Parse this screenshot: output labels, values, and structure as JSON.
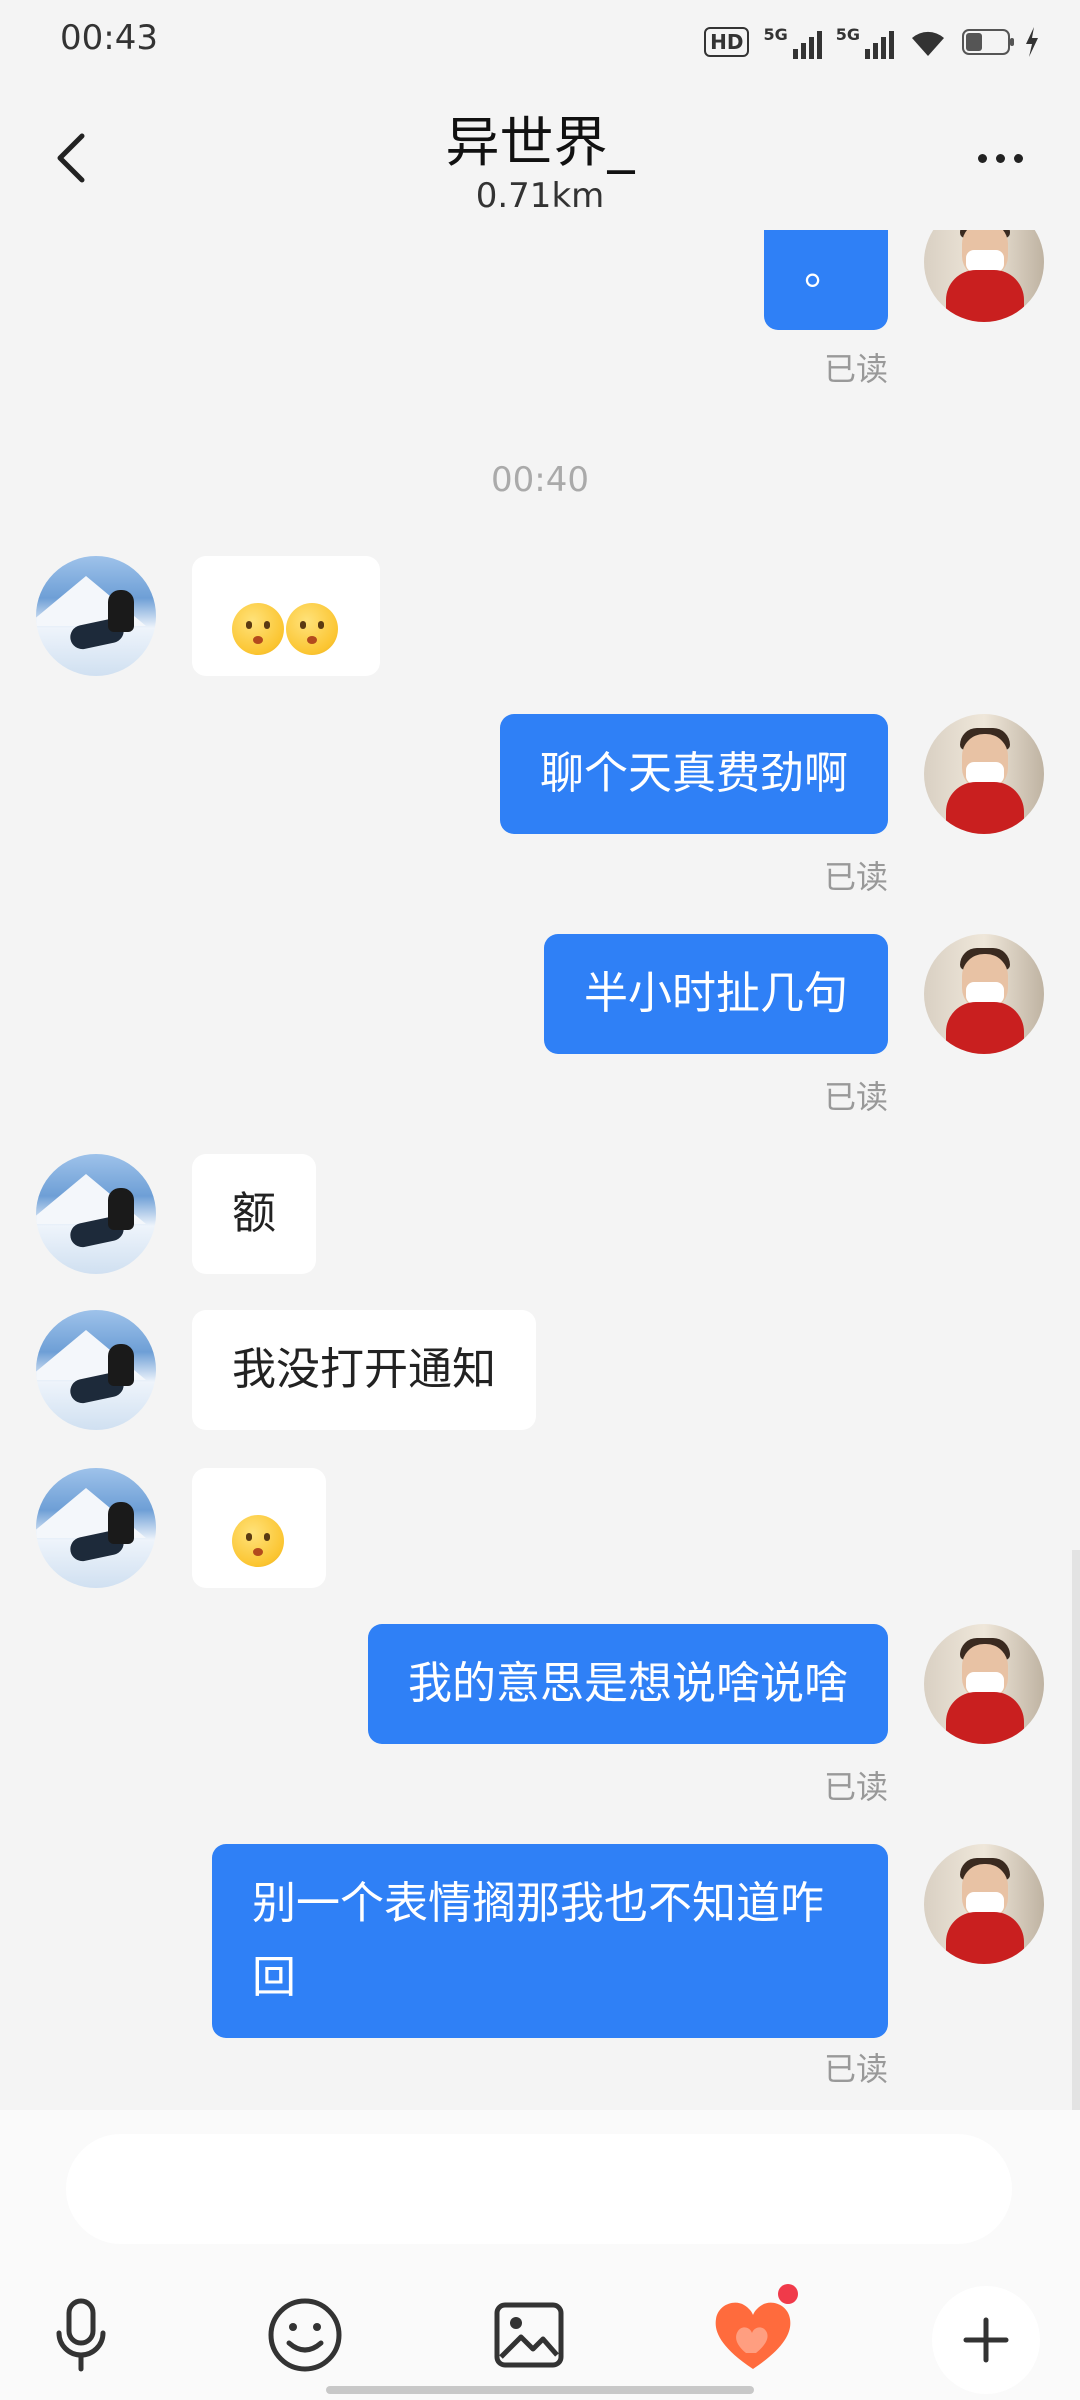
{
  "status_bar": {
    "time": "00:43",
    "hd_label": "HD",
    "network_1": "5G",
    "network_2": "5G",
    "battery_level": 0.45
  },
  "header": {
    "title": "异世界_",
    "distance": "0.71km"
  },
  "chat": {
    "messages": [
      {
        "from": "self",
        "text": "。",
        "status": "已读"
      },
      {
        "type": "timestamp",
        "text": "00:40"
      },
      {
        "from": "peer",
        "emoji_count": 2
      },
      {
        "from": "self",
        "text": "聊个天真费劲啊",
        "status": "已读"
      },
      {
        "from": "self",
        "text": "半小时扯几句",
        "status": "已读"
      },
      {
        "from": "peer",
        "text": "额"
      },
      {
        "from": "peer",
        "text": "我没打开通知"
      },
      {
        "from": "peer",
        "emoji_count": 1
      },
      {
        "from": "self",
        "text": "我的意思是想说啥说啥",
        "status": "已读"
      },
      {
        "from": "self",
        "text": "别一个表情搁那我也不知道咋回",
        "status": "已读"
      }
    ]
  },
  "input": {
    "placeholder": ""
  },
  "toolbar": {
    "icons": [
      "microphone-icon",
      "emoji-icon",
      "image-icon",
      "heart-gift-icon",
      "plus-icon"
    ]
  },
  "colors": {
    "outgoing_bubble": "#2f80f6",
    "incoming_bubble": "#ffffff",
    "background": "#f4f4f4",
    "badge": "#f03a4a",
    "heart": "#ff6b3d"
  }
}
